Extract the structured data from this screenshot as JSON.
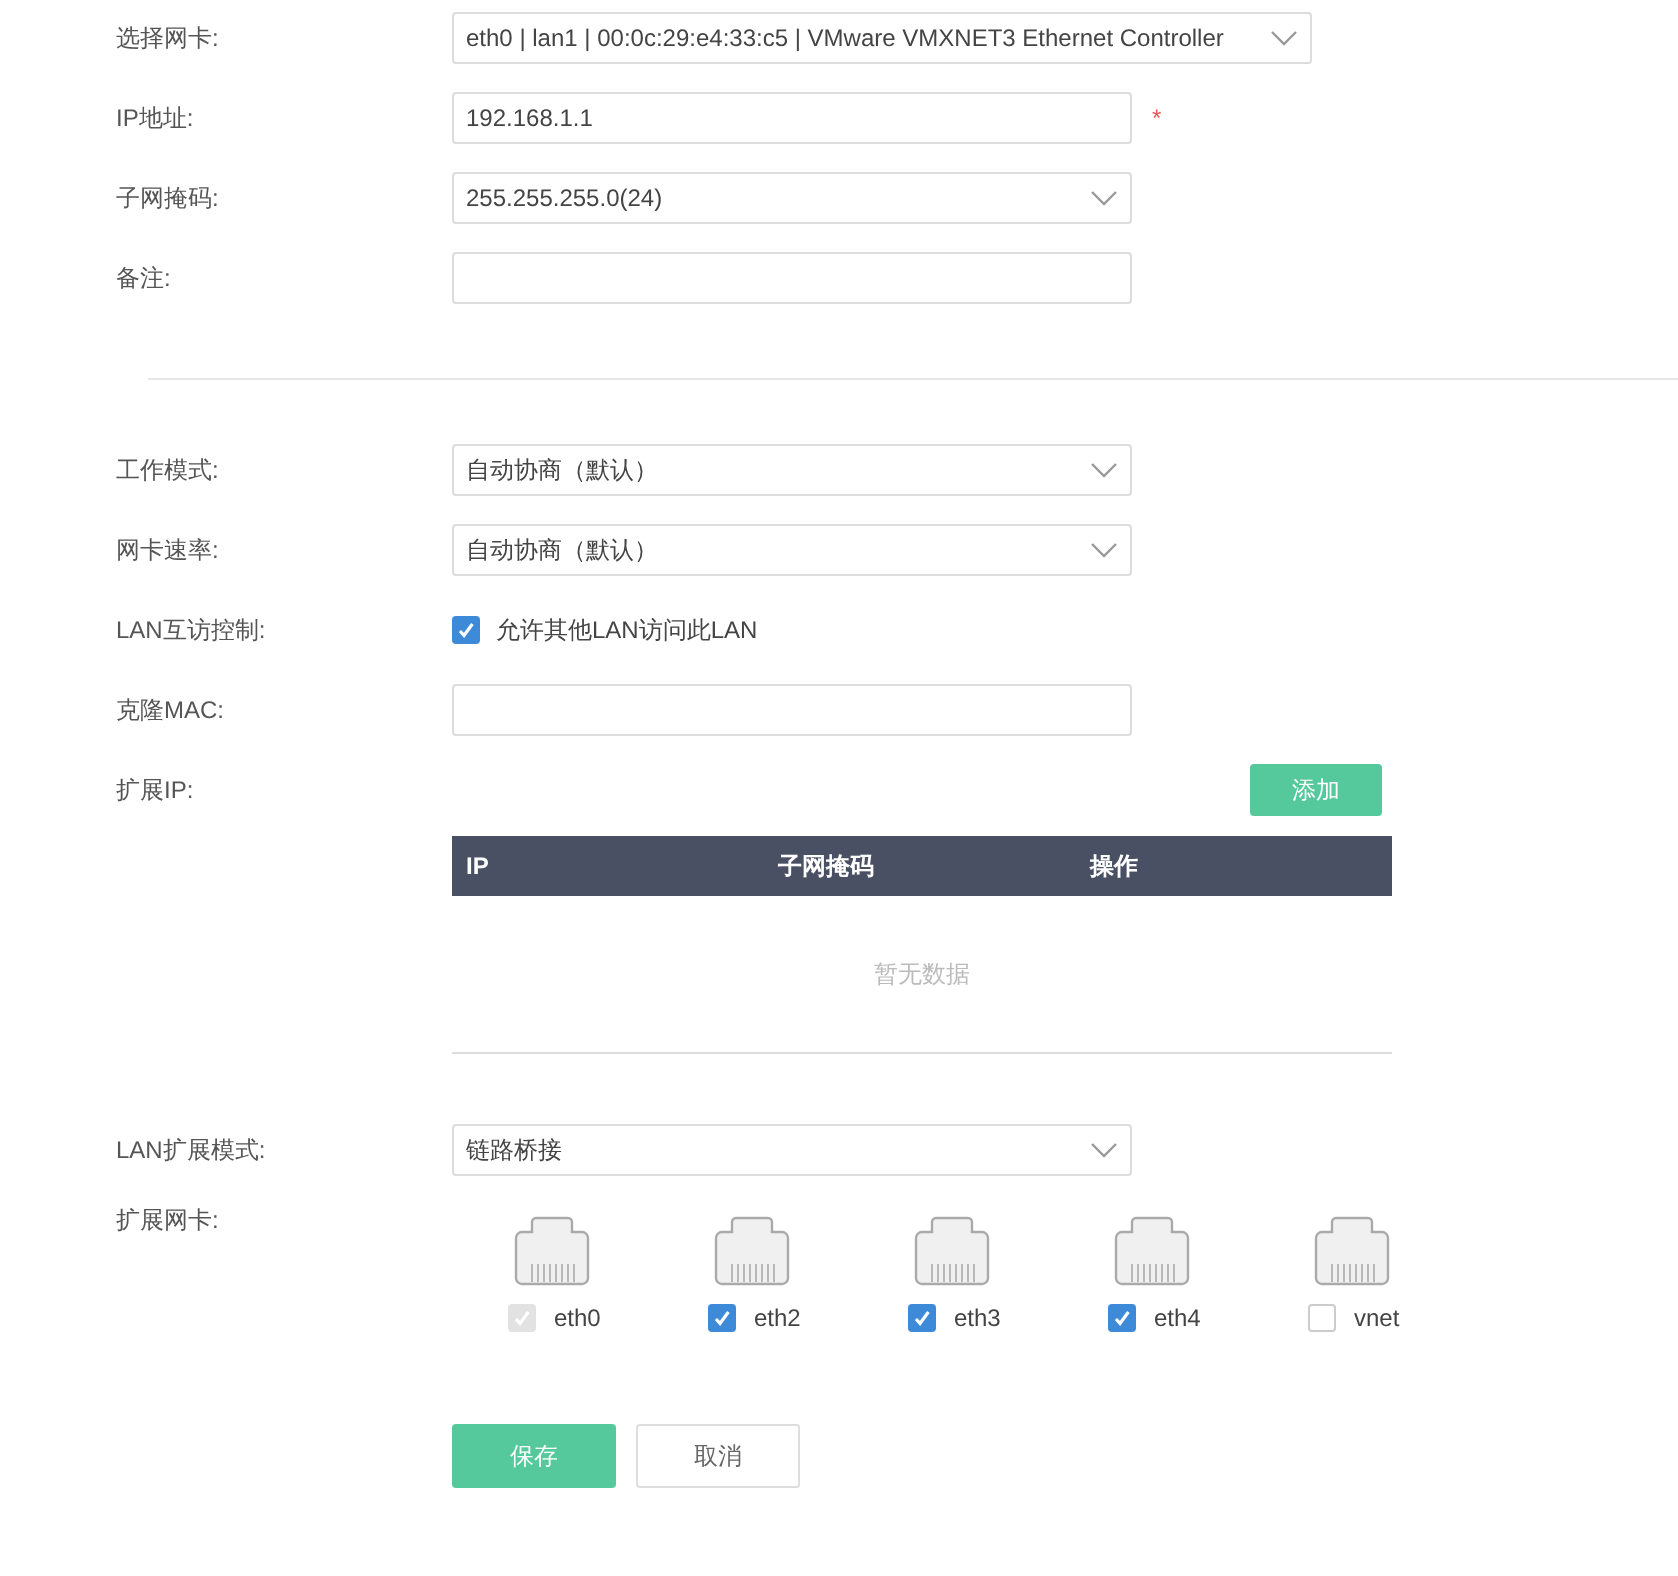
{
  "interface_section": {
    "fields": [
      {
        "kind": "select",
        "label": "选择网卡:",
        "value": "eth0 | lan1 | 00:0c:29:e4:33:c5 | VMware VMXNET3 Ethernet Controller"
      },
      {
        "kind": "input",
        "label": "IP地址:",
        "value": "192.168.1.1",
        "required_mark": "*"
      },
      {
        "kind": "select",
        "label": "子网掩码:",
        "value": "255.255.255.0(24)"
      },
      {
        "kind": "input",
        "label": "备注:"
      }
    ]
  },
  "settings_section": {
    "fields": [
      {
        "kind": "select",
        "label": "工作模式:",
        "value": "自动协商（默认）"
      },
      {
        "kind": "select",
        "label": "网卡速率:",
        "value": "自动协商（默认）"
      },
      {
        "kind": "checkbox",
        "label": "LAN互访控制:",
        "value": "允许其他LAN访问此LAN",
        "checked": true
      },
      {
        "kind": "input",
        "label": "克隆MAC:"
      }
    ]
  },
  "extended_ip": {
    "label": "扩展IP:",
    "add_button": "添加",
    "columns": [
      "IP",
      "子网掩码",
      "操作"
    ],
    "empty_text": "暂无数据"
  },
  "lan_extension": {
    "mode_label": "LAN扩展模式:",
    "mode_value": "链路桥接",
    "nics_label": "扩展网卡:",
    "nics": [
      {
        "name": "eth0",
        "checked": true,
        "disabled": true
      },
      {
        "name": "eth2",
        "checked": true,
        "disabled": false
      },
      {
        "name": "eth3",
        "checked": true,
        "disabled": false
      },
      {
        "name": "eth4",
        "checked": true,
        "disabled": false
      },
      {
        "name": "vnet",
        "checked": false,
        "disabled": false
      }
    ]
  },
  "actions": {
    "save": "保存",
    "cancel": "取消"
  }
}
